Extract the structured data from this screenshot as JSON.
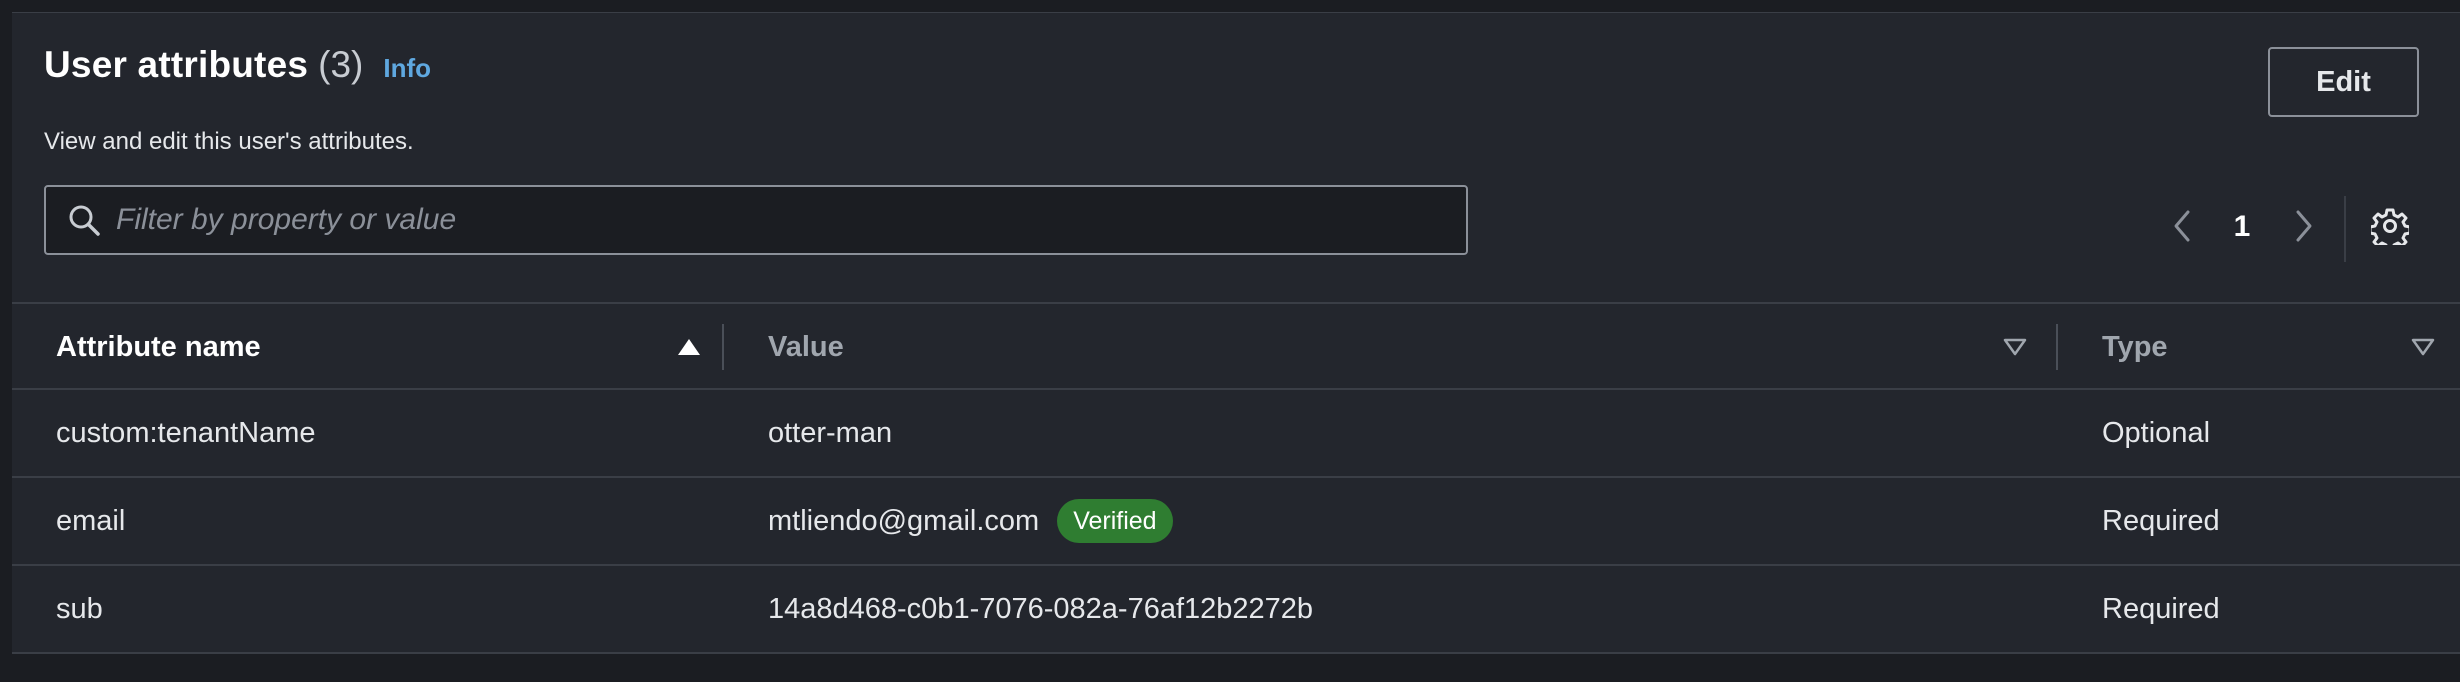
{
  "header": {
    "title": "User attributes",
    "count": "(3)",
    "info_label": "Info",
    "subtitle": "View and edit this user's attributes.",
    "edit_label": "Edit"
  },
  "search": {
    "placeholder": "Filter by property or value",
    "value": ""
  },
  "pagination": {
    "current_page": "1"
  },
  "table": {
    "columns": [
      "Attribute name",
      "Value",
      "Type"
    ],
    "rows": [
      {
        "name": "custom:tenantName",
        "value": "otter-man",
        "badge": "",
        "type": "Optional"
      },
      {
        "name": "email",
        "value": "mtliendo@gmail.com",
        "badge": "Verified",
        "type": "Required"
      },
      {
        "name": "sub",
        "value": "14a8d468-c0b1-7076-082a-76af12b2272b",
        "badge": "",
        "type": "Required"
      }
    ]
  },
  "icons": {
    "search": "search-icon",
    "prev": "chevron-left-icon",
    "next": "chevron-right-icon",
    "settings": "gear-icon",
    "sort_active": "sort-ascending-icon",
    "sort_inactive": "sort-indicator-icon"
  },
  "colors": {
    "background": "#1b1d22",
    "panel": "#23262d",
    "link": "#5fa8e0",
    "badge_success": "#2f7d31"
  }
}
